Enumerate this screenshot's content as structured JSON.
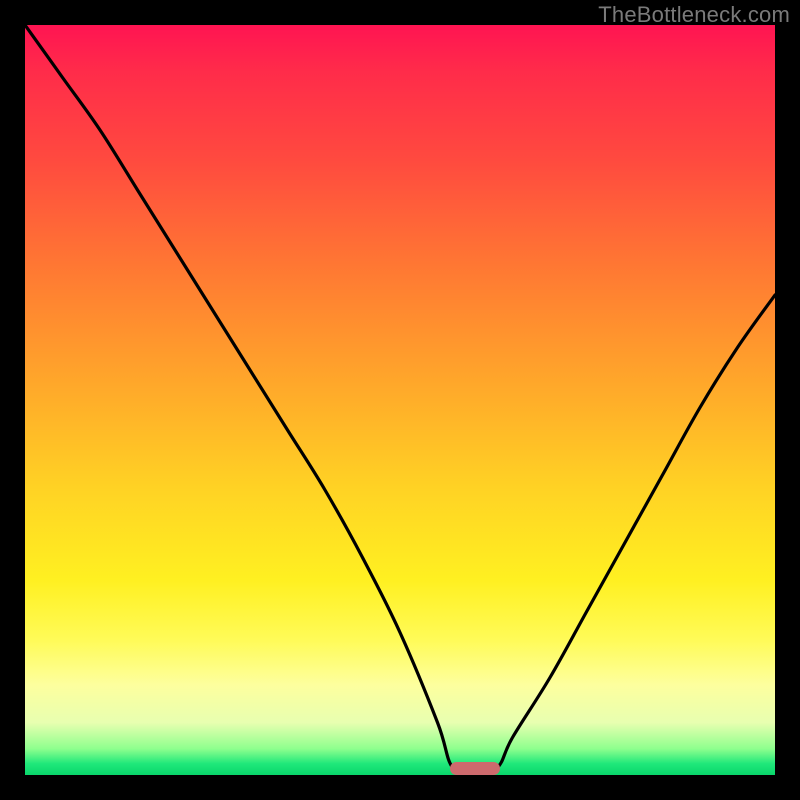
{
  "watermark": "TheBottleneck.com",
  "marker": {
    "color": "#cd6a6d",
    "x_pct": 60,
    "y_pct": 99.1
  },
  "chart_data": {
    "type": "line",
    "title": "",
    "xlabel": "",
    "ylabel": "",
    "xlim": [
      0,
      100
    ],
    "ylim": [
      0,
      100
    ],
    "grid": false,
    "legend": false,
    "series": [
      {
        "name": "bottleneck-curve",
        "x": [
          0,
          5,
          10,
          15,
          20,
          25,
          30,
          35,
          40,
          45,
          50,
          55,
          57,
          60,
          63,
          65,
          70,
          75,
          80,
          85,
          90,
          95,
          100
        ],
        "y": [
          100,
          93,
          86,
          78,
          70,
          62,
          54,
          46,
          38,
          29,
          19,
          7,
          1,
          0,
          1,
          5,
          13,
          22,
          31,
          40,
          49,
          57,
          64
        ]
      }
    ],
    "annotations": [
      {
        "type": "marker",
        "shape": "rounded-bar",
        "x": 60,
        "y": 0.9,
        "color": "#cd6a6d"
      }
    ],
    "background_gradient": {
      "direction": "vertical",
      "stops": [
        {
          "pct": 0,
          "color": "#ff1452"
        },
        {
          "pct": 50,
          "color": "#ffb627"
        },
        {
          "pct": 80,
          "color": "#fff94f"
        },
        {
          "pct": 100,
          "color": "#09d66b"
        }
      ]
    }
  }
}
